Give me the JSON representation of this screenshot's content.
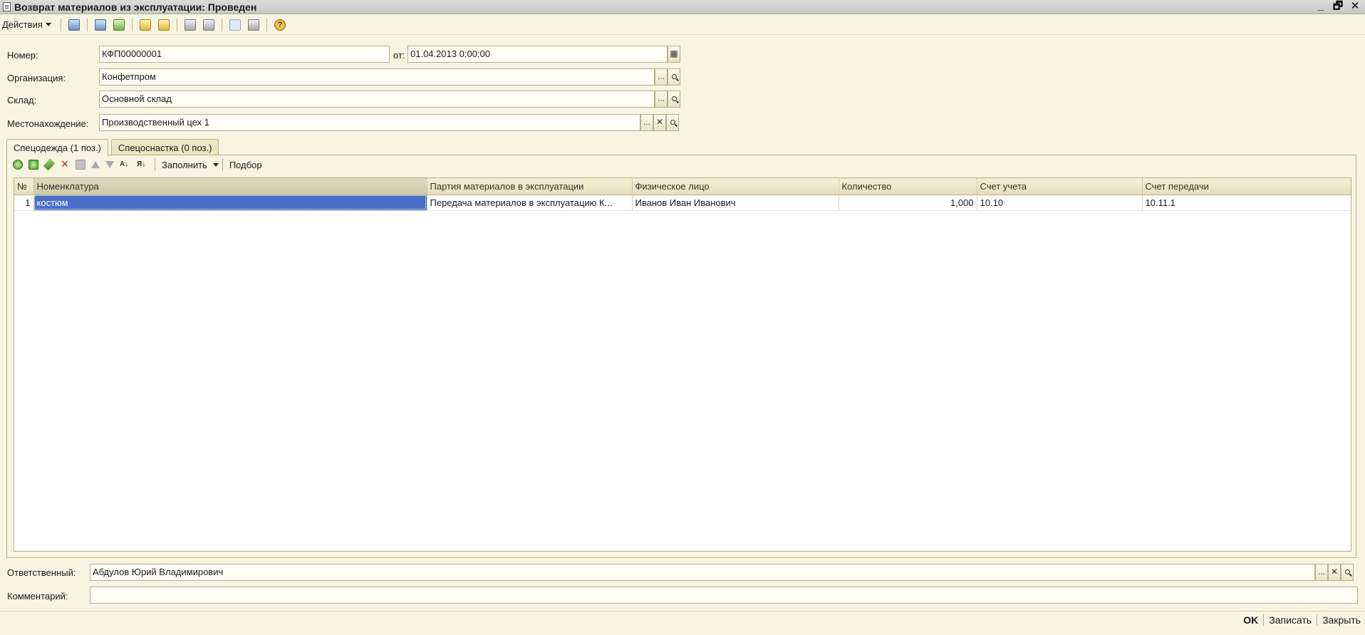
{
  "window": {
    "title": "Возврат материалов из эксплуатации: Проведен",
    "minimize": "_",
    "restore": "🗗",
    "close": "✕"
  },
  "toolbar": {
    "actions_label": "Действия",
    "help_icon_text": "?"
  },
  "fields": {
    "number_label": "Номер:",
    "number_value": "КФП00000001",
    "date_label": "от:",
    "date_value": "01.04.2013  0:00:00",
    "organization_label": "Организация:",
    "organization_value": "Конфетпром",
    "warehouse_label": "Склад:",
    "warehouse_value": "Основной склад",
    "location_label": "Местонахождение:",
    "location_value": "Производственный цех 1",
    "select_button": "...",
    "clear_button": "✕"
  },
  "tabs": [
    {
      "label": "Спецодежда (1 поз.)"
    },
    {
      "label": "Спецоснастка (0 поз.)"
    }
  ],
  "table_toolbar": {
    "fill_label": "Заполнить",
    "pick_label": "Подбор"
  },
  "table": {
    "columns": [
      "№",
      "Номенклатура",
      "Партия материалов в эксплуатации",
      "Физическое лицо",
      "Количество",
      "Счет учета",
      "Счет передачи"
    ],
    "rows": [
      [
        "1",
        "костюм",
        "Передача материалов в эксплуатацию К...",
        "Иванов Иван Иванович",
        "1,000",
        "10.10",
        "10.11.1"
      ]
    ]
  },
  "footer": {
    "responsible_label": "Ответственный:",
    "responsible_value": "Абдулов Юрий Владимирович",
    "comment_label": "Комментарий:",
    "comment_value": "",
    "ok_button": "OK",
    "save_button": "Записать",
    "close_button": "Закрыть"
  }
}
